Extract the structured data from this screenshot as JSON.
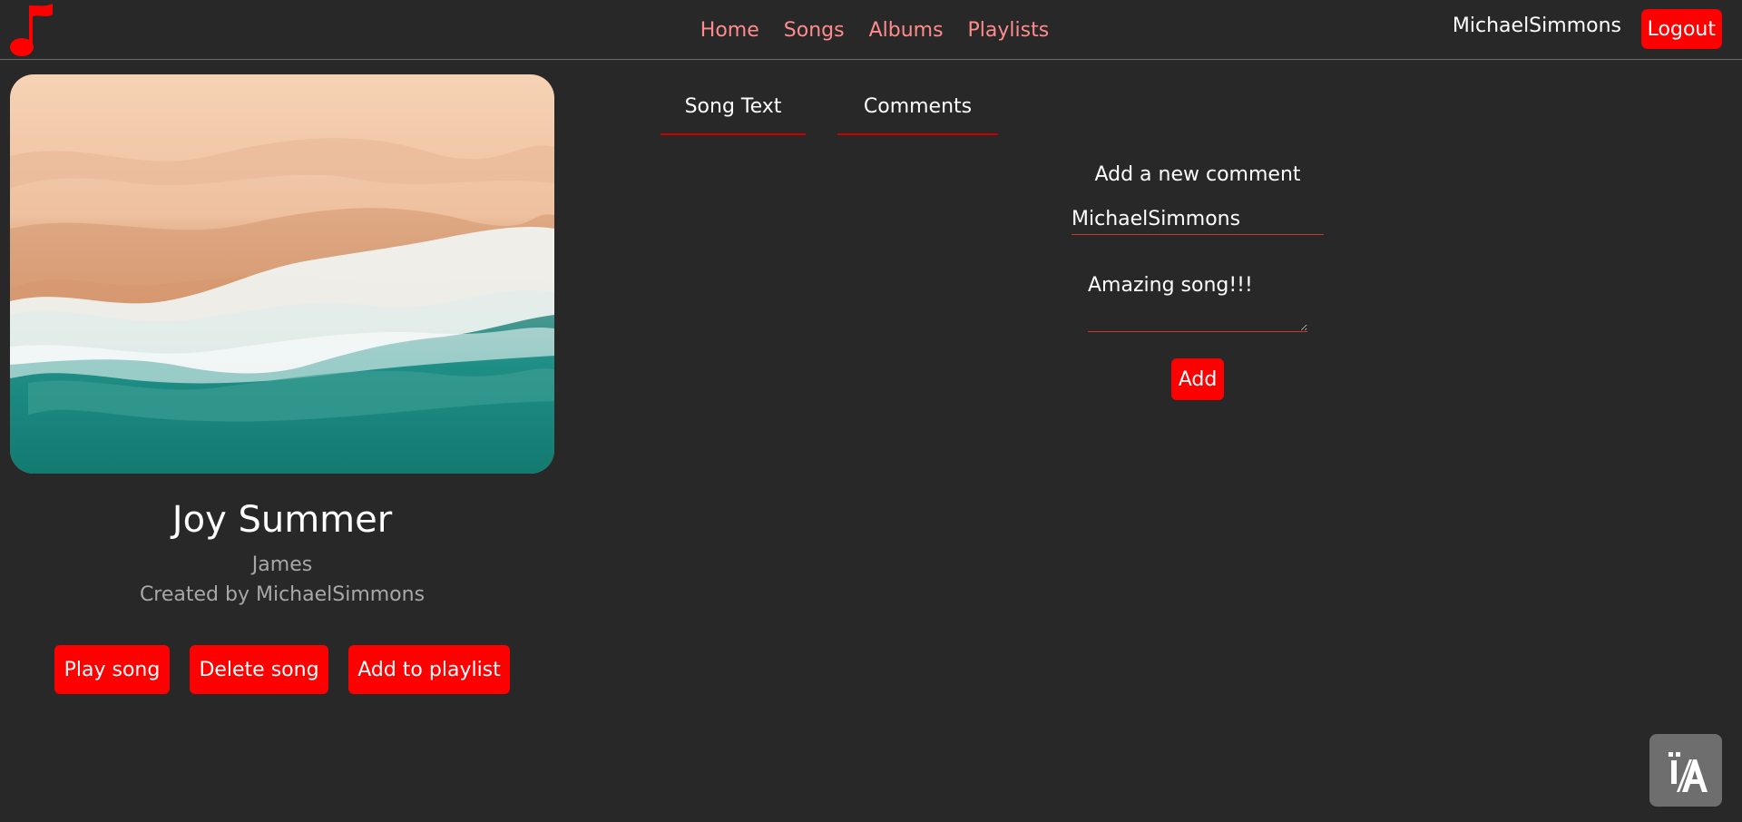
{
  "header": {
    "nav": [
      {
        "label": "Home"
      },
      {
        "label": "Songs"
      },
      {
        "label": "Albums"
      },
      {
        "label": "Playlists"
      }
    ],
    "username": "MichaelSimmons",
    "logout_label": "Logout",
    "logo_icon": "music-note-icon"
  },
  "song": {
    "title": "Joy Summer",
    "artist": "James",
    "creator": "Created by MichaelSimmons",
    "cover_image": "aerial-beach-waves"
  },
  "actions": {
    "play_label": "Play song",
    "delete_label": "Delete song",
    "playlist_label": "Add to playlist"
  },
  "tabs": [
    {
      "label": "Song Text"
    },
    {
      "label": "Comments"
    }
  ],
  "comment_form": {
    "heading": "Add a new comment",
    "name_value": "MichaelSimmons",
    "comment_value": "Amazing song!!!",
    "add_label": "Add"
  },
  "accessibility": {
    "icon": "accessibility-text-icon"
  },
  "colors": {
    "background": "#282828",
    "accent": "#ff0000",
    "nav_link": "#ff8c8c",
    "muted_text": "#a8a8a8"
  }
}
